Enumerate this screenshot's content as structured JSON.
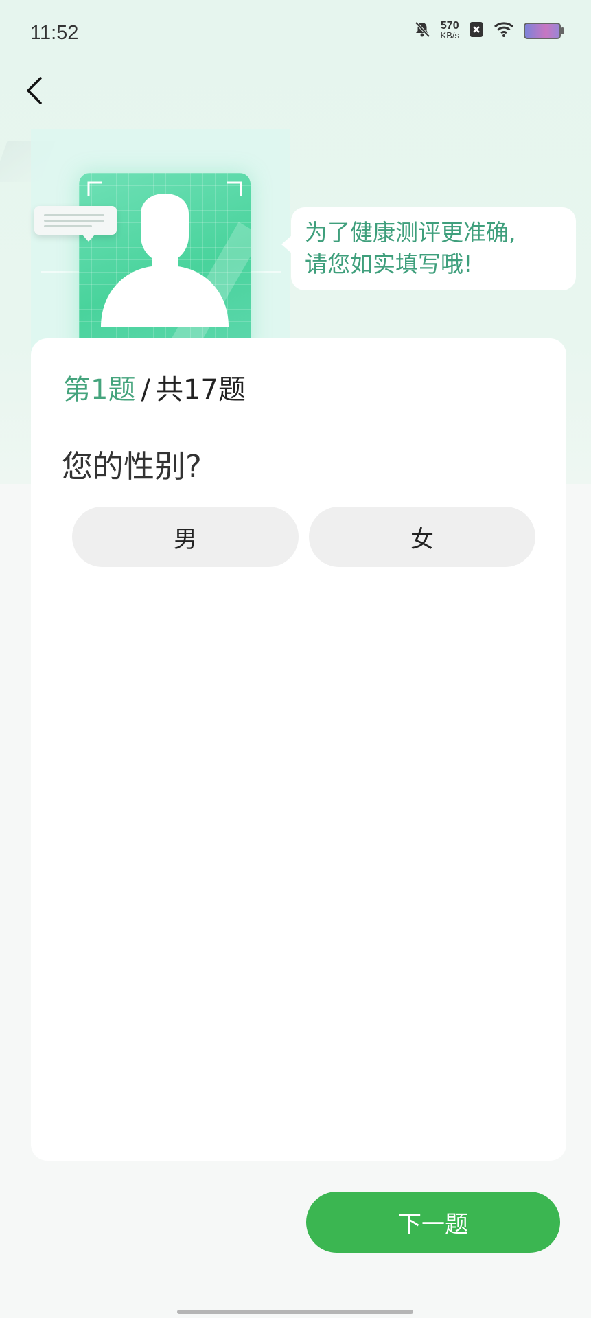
{
  "status_bar": {
    "time": "11:52",
    "net_speed_value": "570",
    "net_speed_unit": "KB/s",
    "icons": [
      "bell-mute-icon",
      "close-box-icon",
      "wifi-icon",
      "battery-icon"
    ]
  },
  "nav": {
    "back_icon": "chevron-left-icon"
  },
  "hero": {
    "speech_line1": "为了健康测评更准确,",
    "speech_line2": "请您如实填写哦!"
  },
  "progress": {
    "current": "第1题",
    "separator": "/",
    "total": "共17题"
  },
  "question": {
    "text": "您的性别?",
    "options": [
      "男",
      "女"
    ]
  },
  "next_button": {
    "label": "下一题"
  },
  "colors": {
    "accent_green": "#3bb651",
    "progress_green": "#45a47d",
    "avatar_green": "#49d39c",
    "speech_text": "#3f9f7c"
  }
}
